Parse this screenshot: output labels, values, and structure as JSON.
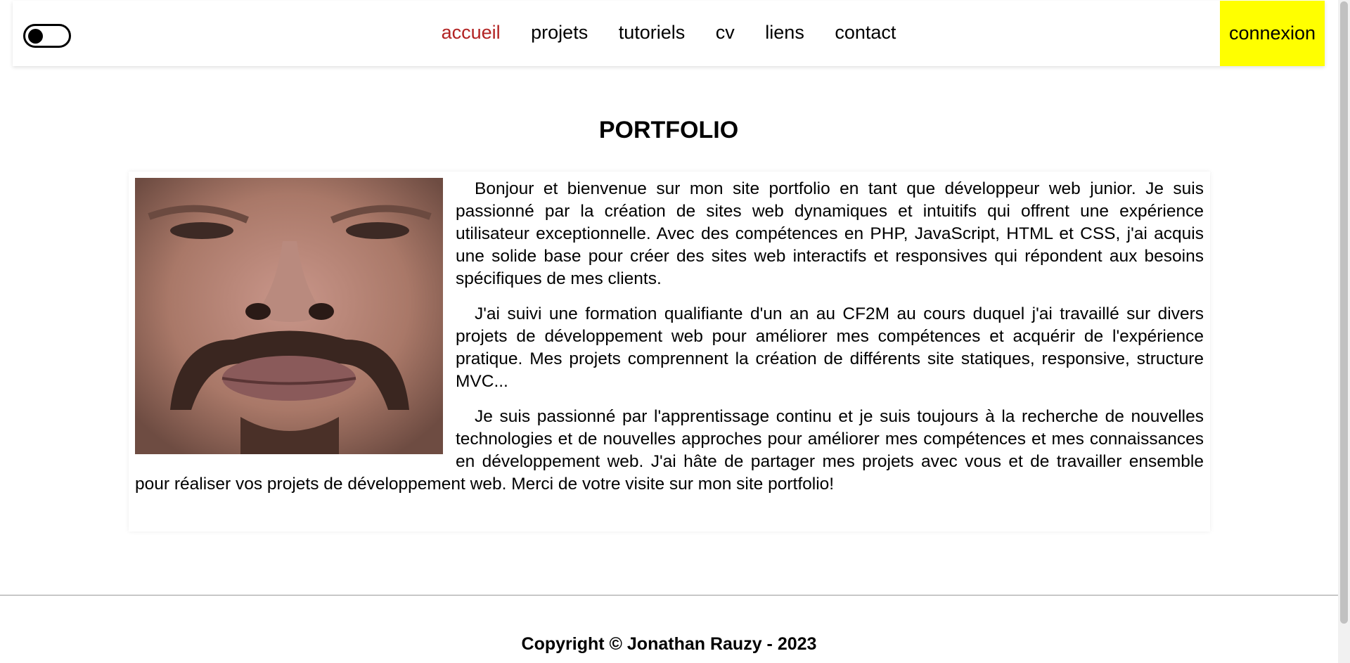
{
  "nav": {
    "items": [
      {
        "label": "accueil",
        "active": true
      },
      {
        "label": "projets"
      },
      {
        "label": "tutoriels"
      },
      {
        "label": "cv"
      },
      {
        "label": "liens"
      },
      {
        "label": "contact"
      }
    ],
    "login_label": "connexion",
    "login_bg": "#ffff00",
    "active_color": "#b22222"
  },
  "main": {
    "title": "PORTFOLIO",
    "paragraphs": [
      "Bonjour et bienvenue sur mon site portfolio en tant que développeur web junior. Je suis passionné par la création de sites web dynamiques et intuitifs qui offrent une expérience utilisateur exceptionnelle. Avec des compétences en PHP, JavaScript, HTML et CSS, j'ai acquis une solide base pour créer des sites web interactifs et responsives qui répondent aux besoins spécifiques de mes clients.",
      "J'ai suivi une formation qualifiante d'un an au CF2M au cours duquel j'ai travaillé sur divers projets de développement web pour améliorer mes compétences et acquérir de l'expérience pratique. Mes projets comprennent la création de différents site statiques, responsive, structure MVC...",
      "Je suis passionné par l'apprentissage continu et je suis toujours à la recherche de nouvelles technologies et de nouvelles approches pour améliorer mes compétences et mes connaissances en développement web. J'ai hâte de partager mes projets avec vous et de travailler ensemble pour réaliser vos projets de développement web. Merci de votre visite sur mon site portfolio!"
    ]
  },
  "footer": {
    "copyright": "Copyright © Jonathan Rauzy - 2023"
  }
}
